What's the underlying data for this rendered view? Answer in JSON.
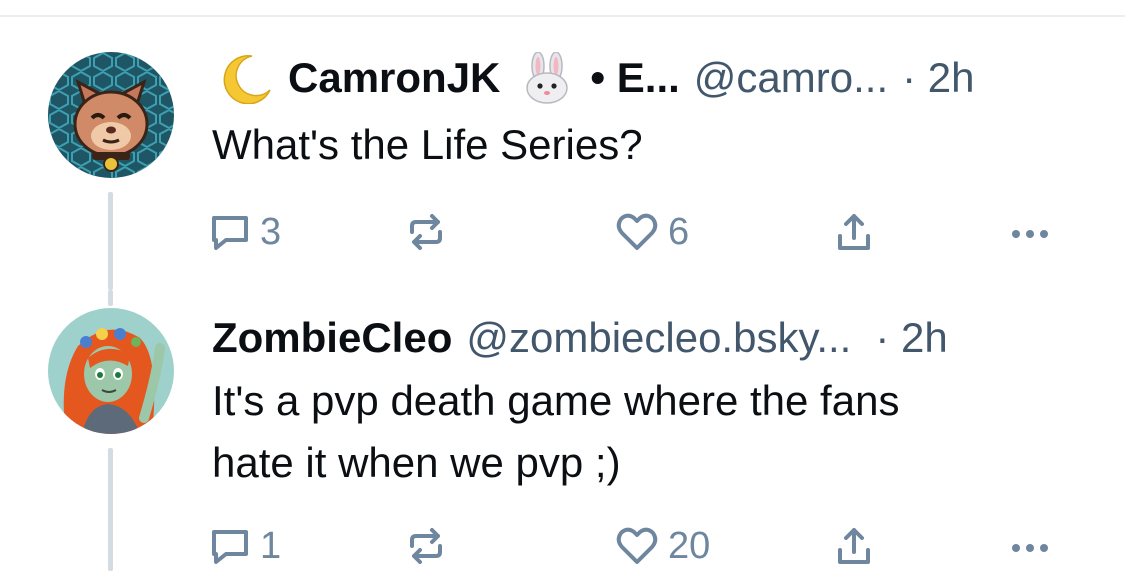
{
  "posts": [
    {
      "display_name": "CamronJK",
      "name_suffix": "• E...",
      "handle": "@camro...",
      "time": "· 2h",
      "text": "What's the Life Series?",
      "emoji_prefix": "moon-emoji",
      "emoji_suffix": "rabbit-emoji",
      "avatar": "cat-avatar",
      "actions": {
        "replies": "3",
        "reposts": "",
        "likes": "6"
      }
    },
    {
      "display_name": "ZombieCleo",
      "handle": "@zombiecleo.bsky...",
      "time": "· 2h",
      "text_line1": "It's a pvp death game where the fans",
      "text_line2": "hate it when we pvp ;)",
      "avatar": "zombie-avatar",
      "actions": {
        "replies": "1",
        "reposts": "",
        "likes": "20"
      }
    }
  ],
  "colors": {
    "text": "#0b0f14",
    "secondary": "#42576c",
    "icon": "#6f869f",
    "thread_line": "#d4dbe2"
  }
}
